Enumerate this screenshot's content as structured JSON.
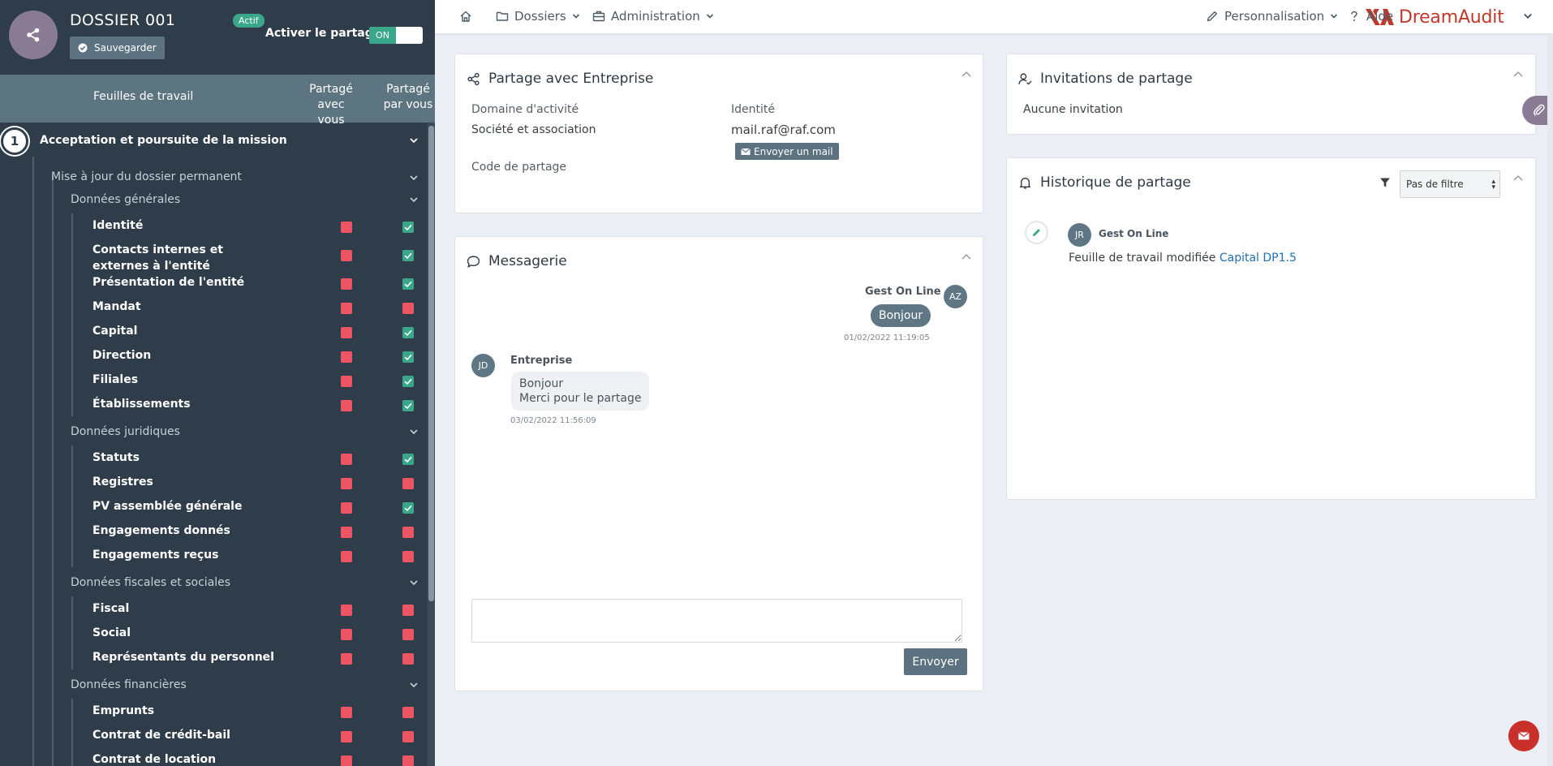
{
  "header": {
    "dossier_title": "DOSSIER 001",
    "save_label": "Sauvegarder",
    "status_badge": "Actif",
    "share_label": "Activer le partage",
    "toggle_on": "ON"
  },
  "columns": {
    "sheets": "Feuilles de travail",
    "shared_with_you_l1": "Partagé",
    "shared_with_you_l2": "avec vous",
    "shared_by_you_l1": "Partagé",
    "shared_by_you_l2": "par vous"
  },
  "section": {
    "number": "1",
    "title": "Acceptation et poursuite de la mission",
    "sub": "Mise à jour du dossier permanent",
    "groups": [
      {
        "label": "Données générales",
        "items": [
          {
            "label": "Identité",
            "with_you": false,
            "by_you": true
          },
          {
            "label": "Contacts internes et externes à l'entité",
            "with_you": false,
            "by_you": true
          },
          {
            "label": "Présentation de l'entité",
            "with_you": false,
            "by_you": true
          },
          {
            "label": "Mandat",
            "with_you": false,
            "by_you": false
          },
          {
            "label": "Capital",
            "with_you": false,
            "by_you": true
          },
          {
            "label": "Direction",
            "with_you": false,
            "by_you": true
          },
          {
            "label": "Filiales",
            "with_you": false,
            "by_you": true
          },
          {
            "label": "Établissements",
            "with_you": false,
            "by_you": true
          }
        ]
      },
      {
        "label": "Données juridiques",
        "items": [
          {
            "label": "Statuts",
            "with_you": false,
            "by_you": true
          },
          {
            "label": "Registres",
            "with_you": false,
            "by_you": false
          },
          {
            "label": "PV assemblée générale",
            "with_you": false,
            "by_you": true
          },
          {
            "label": "Engagements donnés",
            "with_you": false,
            "by_you": false
          },
          {
            "label": "Engagements reçus",
            "with_you": false,
            "by_you": false
          }
        ]
      },
      {
        "label": "Données fiscales et sociales",
        "items": [
          {
            "label": "Fiscal",
            "with_you": false,
            "by_you": false
          },
          {
            "label": "Social",
            "with_you": false,
            "by_you": false
          },
          {
            "label": "Représentants du personnel",
            "with_you": false,
            "by_you": false
          }
        ]
      },
      {
        "label": "Données financières",
        "items": [
          {
            "label": "Emprunts",
            "with_you": false,
            "by_you": false
          },
          {
            "label": "Contrat de crédit-bail",
            "with_you": false,
            "by_you": false
          },
          {
            "label": "Contrat de location",
            "with_you": false,
            "by_you": false
          }
        ]
      }
    ]
  },
  "topnav": {
    "dossiers": "Dossiers",
    "administration": "Administration",
    "logo_dream": "Dream",
    "logo_audit": "Audit",
    "personnalisation": "Personnalisation",
    "aide": "Aide"
  },
  "share_card": {
    "title": "Partage avec Entreprise",
    "domain_label": "Domaine d'activité",
    "domain_value": "Société et association",
    "identity_label": "Identité",
    "identity_value": "mail.raf@raf.com",
    "mail_button": "Envoyer un mail",
    "code_label": "Code de partage"
  },
  "messagerie": {
    "title": "Messagerie",
    "messages": [
      {
        "initials": "AZ",
        "name": "Gest On Line",
        "text": "Bonjour",
        "time": "01/02/2022 11:19:05"
      },
      {
        "initials": "JD",
        "name": "Entreprise",
        "text_l1": "Bonjour",
        "text_l2": "Merci pour le partage",
        "time": "03/02/2022 11:56:09"
      }
    ],
    "input_value": "",
    "send_label": "Envoyer"
  },
  "invitations": {
    "title": "Invitations de partage",
    "empty": "Aucune invitation"
  },
  "history": {
    "title": "Historique de partage",
    "filter_value": "Pas de filtre",
    "entries": [
      {
        "initials": "JR",
        "name": "Gest On Line",
        "action": "Feuille de travail modifiée",
        "link": "Capital DP1.5"
      }
    ]
  },
  "icons": [
    "share-icon",
    "check-circle-icon",
    "home-icon",
    "folder-icon",
    "briefcase-icon",
    "chevron-down-icon",
    "pencil-icon",
    "question-icon",
    "nodes-icon",
    "comment-icon",
    "user-check-icon",
    "bell-icon",
    "filter-icon",
    "envelope-icon",
    "paperclip-icon",
    "chevron-up-icon"
  ],
  "colors": {
    "sidebar": "#2e3d49",
    "column_header": "#5d7581",
    "accent_green": "#3aa68a",
    "accent_red": "#ed5565",
    "brand": "#c0392b",
    "button": "#5c7280"
  }
}
